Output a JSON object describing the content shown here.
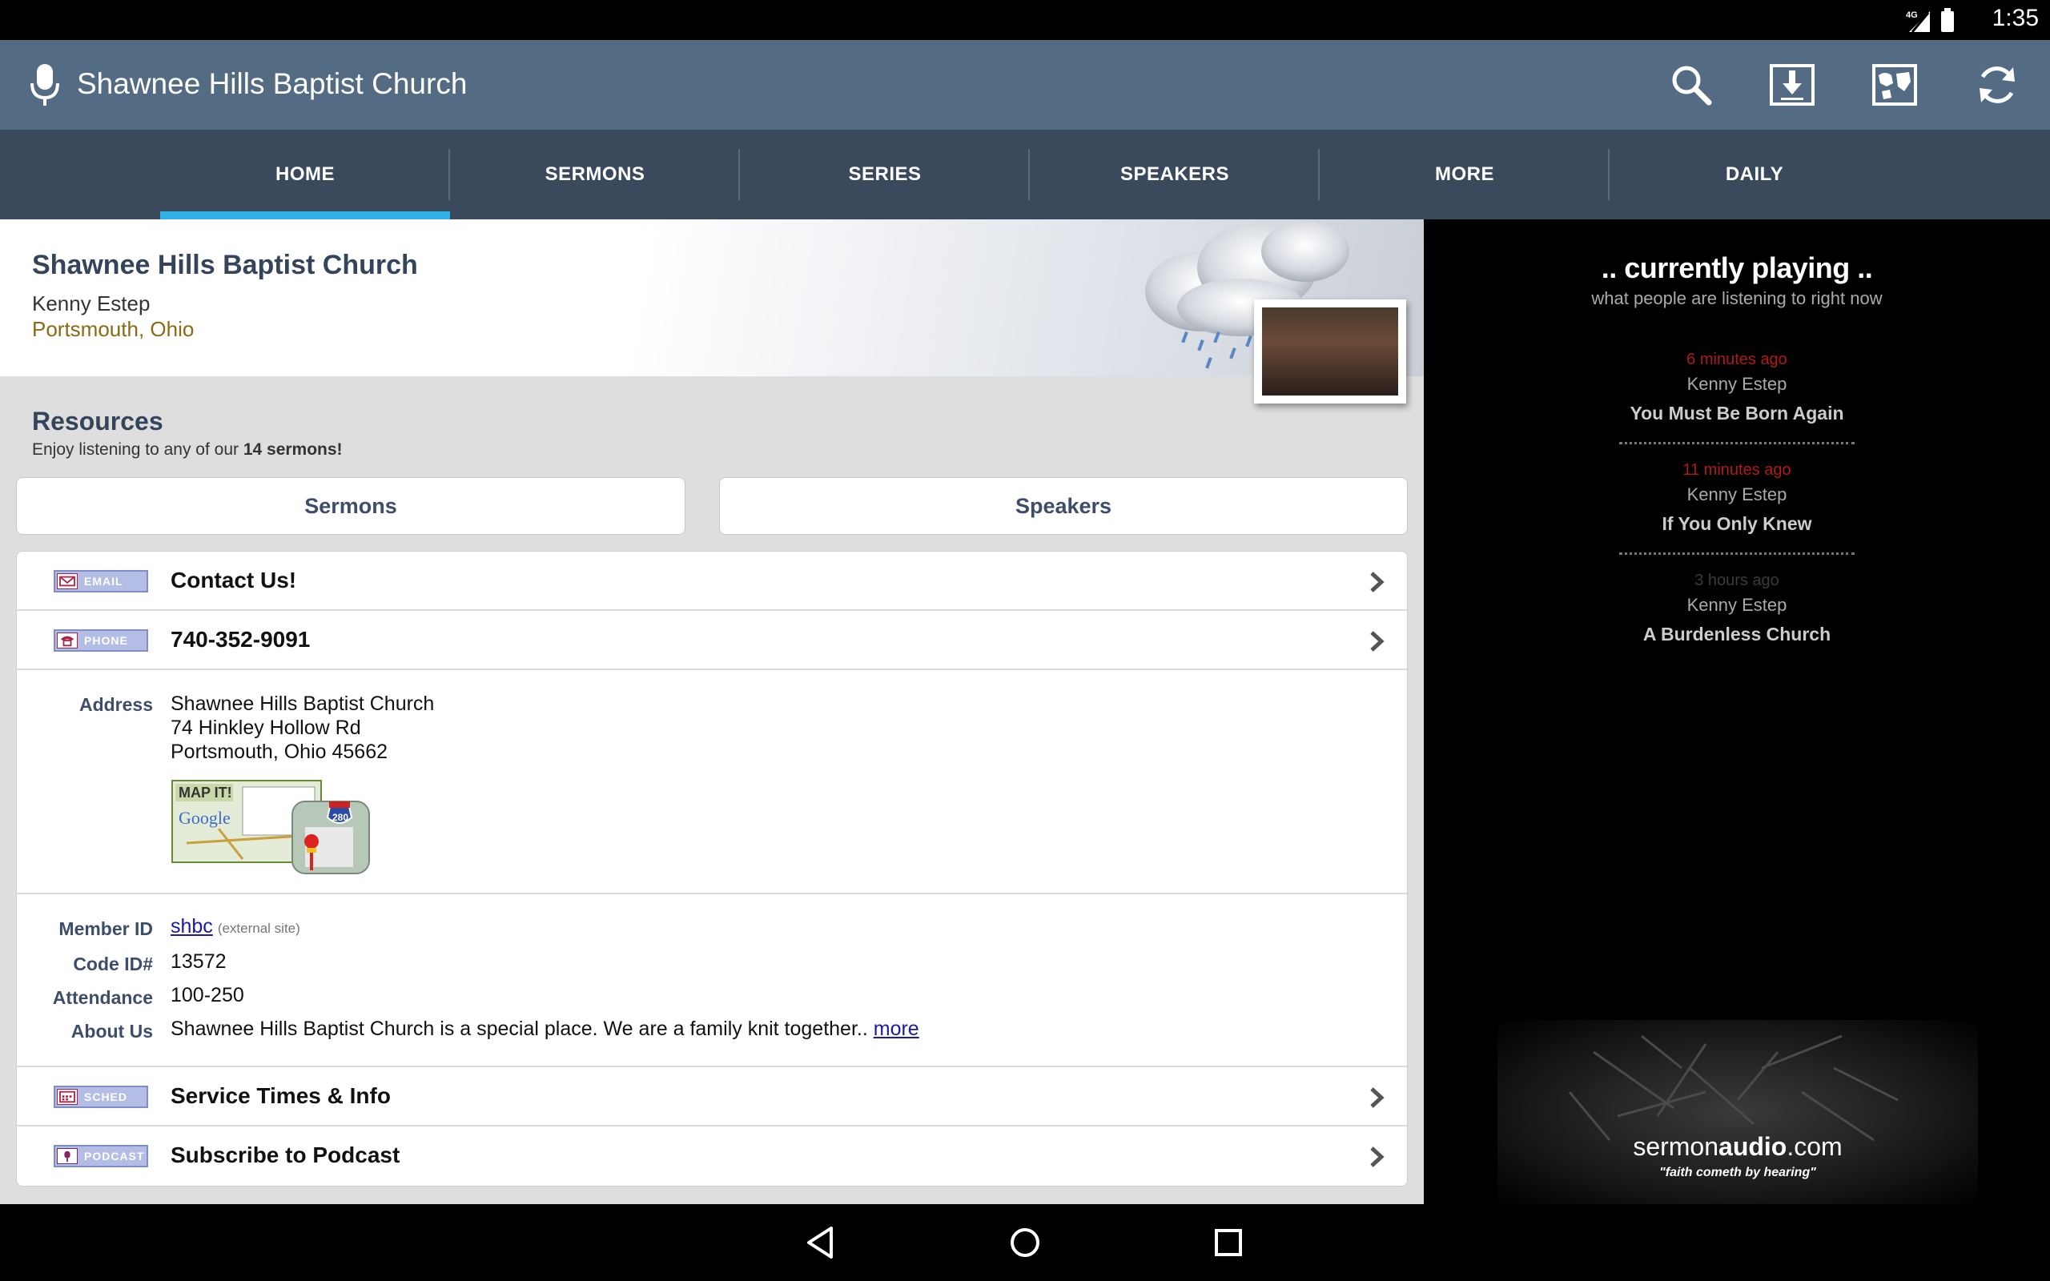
{
  "status": {
    "network": "4G",
    "time": "1:35"
  },
  "appbar": {
    "title": "Shawnee Hills Baptist Church"
  },
  "tabs": [
    {
      "label": "HOME",
      "active": true
    },
    {
      "label": "SERMONS",
      "active": false
    },
    {
      "label": "SERIES",
      "active": false
    },
    {
      "label": "SPEAKERS",
      "active": false
    },
    {
      "label": "MORE",
      "active": false
    },
    {
      "label": "DAILY",
      "active": false
    }
  ],
  "header": {
    "church_name": "Shawnee Hills Baptist Church",
    "pastor": "Kenny Estep",
    "location": "Portsmouth, Ohio"
  },
  "resources": {
    "title": "Resources",
    "subtitle_prefix": "Enjoy listening to any of our ",
    "subtitle_bold": "14 sermons!",
    "buttons": {
      "sermons": "Sermons",
      "speakers": "Speakers"
    }
  },
  "contact": {
    "email_badge": "EMAIL",
    "email_label": "Contact Us!",
    "phone_badge": "PHONE",
    "phone_label": "740-352-9091"
  },
  "address": {
    "label": "Address",
    "line1": "Shawnee Hills Baptist Church",
    "line2": "74 Hinkley Hollow Rd",
    "line3": "Portsmouth, Ohio 45662",
    "mapit_text": "MAP IT!",
    "map_brand": "Google",
    "route_number": "280"
  },
  "details": {
    "member_id_label": "Member ID",
    "member_id": "shbc",
    "external_note": "(external site)",
    "code_label": "Code ID#",
    "code": "13572",
    "attendance_label": "Attendance",
    "attendance": "100-250",
    "about_label": "About Us",
    "about": "Shawnee Hills Baptist Church is a special place. We are a family knit together..",
    "more": "more"
  },
  "links": {
    "sched_badge": "SCHED",
    "service_label": "Service Times & Info",
    "podcast_badge": "PODCAST",
    "podcast_label": "Subscribe to Podcast"
  },
  "side": {
    "title": ".. currently playing ..",
    "subtitle": "what people are listening to right now",
    "items": [
      {
        "ago": "6 minutes ago",
        "speaker": "Kenny Estep",
        "title": "You Must Be Born Again"
      },
      {
        "ago": "11 minutes ago",
        "speaker": "Kenny Estep",
        "title": "If You Only Knew"
      },
      {
        "ago": "3 hours ago",
        "speaker": "Kenny Estep",
        "title": "A Burdenless Church"
      }
    ],
    "brand_a": "sermon",
    "brand_b": "audio",
    "brand_c": ".com",
    "tagline": "\"faith cometh by hearing\""
  },
  "colors": {
    "appbar": "#546b84",
    "tabbar": "#3a4a5c",
    "indicator": "#2fb0e6",
    "accent_text": "#34445b"
  }
}
